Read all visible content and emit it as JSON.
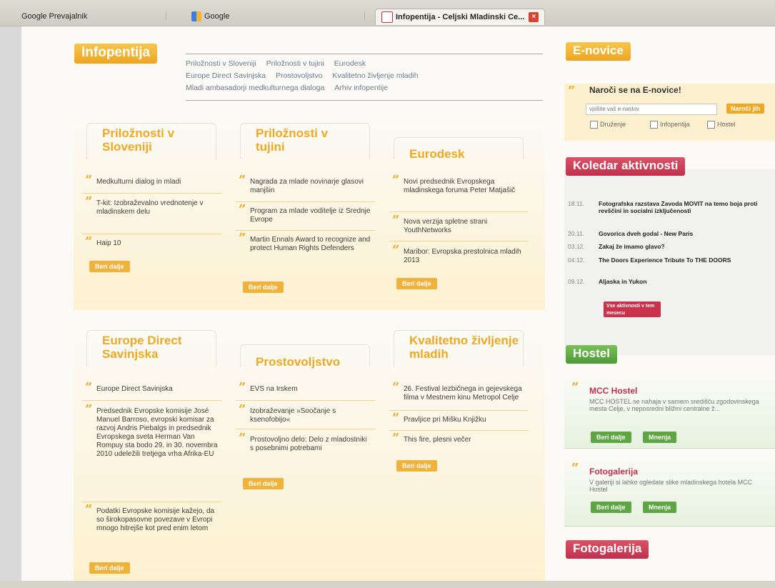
{
  "browser": {
    "tabs": [
      {
        "label": "Google Prevajalnik"
      },
      {
        "label": "Google"
      },
      {
        "label": "Infopentija - Celjski Mladinski Ce..."
      }
    ]
  },
  "header": {
    "title": "Infopentija",
    "nav_row1": [
      "Priložnosti v Sloveniji",
      "Priložnosti v tujini",
      "Eurodesk"
    ],
    "nav_row2": [
      "Europe Direct Savinjska",
      "Prostovoljstvo",
      "Kvalitetno življenje mladih"
    ],
    "nav_row3": [
      "Mladi ambasadorji medkulturnega dialoga",
      "Arhiv infopentije"
    ]
  },
  "more_label": "Beri dalje",
  "columns_top": [
    {
      "title": "Priložnosti v Sloveniji",
      "items": [
        "Medkulturni dialog in mladi",
        "T-kit: Izobraževalno vrednotenje v mladinskem delu",
        "Haip 10"
      ]
    },
    {
      "title": "Priložnosti v tujini",
      "items": [
        "Nagrada za mlade novinarje glasovi manjšin",
        "Program za mlade voditelje iz Srednje Evrope",
        "Martin Ennals Award to recognize and protect Human Rights Defenders"
      ]
    },
    {
      "title": "Eurodesk",
      "items": [
        "Novi predsednik Evropskega mladinskega foruma Peter Matjašič",
        "Nova verzija spletne strani YouthNetworks",
        "Maribor: Evropska prestolnica mladih 2013"
      ]
    }
  ],
  "columns_bottom": [
    {
      "title": "Europe Direct Savinjska",
      "items": [
        "Europe Direct Savinjska",
        "Predsednik Evropske komisije José Manuel Barroso, evropski komisar za razvoj Andris Piebalgs in predsednik Evropskega sveta Herman Van Rompuy sta bodo 29. in 30. novembra 2010 udeležili tretjega vrha Afrika-EU",
        "Podatki Evropske komisije kažejo, da so širokopasovne povezave v Evropi mnogo hitrejše kot pred enim letom"
      ]
    },
    {
      "title": "Prostovoljstvo",
      "items": [
        "EVS na Irskem",
        "Izobraževanje »Soočanje s ksenofobijo«",
        "Prostovoljno delo: Delo z mladostniki s posebnimi potrebami"
      ]
    },
    {
      "title": "Kvalitetno življenje mladih",
      "items": [
        "26. Festival lezbičnega in gejevskega filma v Mestnem kinu Metropol Celje",
        "Pravljice pri Mišku Knjižku",
        "This fire, plesni večer"
      ]
    }
  ],
  "sidebar": {
    "enovice": {
      "title": "E-novice",
      "subscribe_title": "Naroči se na E-novice!",
      "input_placeholder": "vpišite vaš e-naslov",
      "button": "Naroči jih",
      "checkboxes": [
        "Druženje",
        "Infopentija",
        "Hostel"
      ]
    },
    "calendar": {
      "title": "Koledar aktivnosti",
      "events": [
        {
          "date": "18.11.",
          "text": "Fotografska razstava Zavoda MOVIT na temo boja proti revščini in socialni izključenosti"
        },
        {
          "date": "20.11.",
          "text": "Govorica dveh godal - New Paris"
        },
        {
          "date": "03.12.",
          "text": "Zakaj že imamo glavo?"
        },
        {
          "date": "04.12.",
          "text": "The Doors Experience Tribute To THE DOORS"
        },
        {
          "date": "09.12.",
          "text": "Aljaska in Yukon"
        }
      ],
      "button": "Vse aktivnosti v tem mesecu"
    },
    "hostel": {
      "title": "Hostel",
      "blocks": [
        {
          "title": "MCC Hostel",
          "text": "MCC HOSTEL se nahaja v samem središču zgodovinskega mesta Celje, v neposredni bližini centralne ž...",
          "btn1": "Beri dalje",
          "btn2": "Mnenja"
        },
        {
          "title": "Fotogalerija",
          "text": "V galeriji si lahko ogledate slike mladinskega hotela MCC Hostel",
          "btn1": "Beri dalje",
          "btn2": "Mnenja"
        }
      ]
    },
    "fotogalerija": {
      "title": "Fotogalerija"
    }
  },
  "colors": {
    "orange": "#f0a823",
    "red": "#c0304d",
    "green": "#5ea543"
  }
}
